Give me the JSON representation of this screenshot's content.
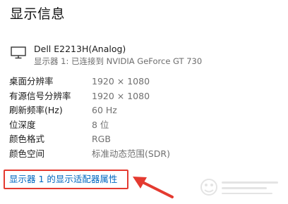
{
  "page": {
    "title": "显示信息"
  },
  "monitor": {
    "icon": "monitor-icon",
    "name": "Dell E2213H(Analog)",
    "subtitle": "显示器 1: 已连接到 NVIDIA GeForce GT 730"
  },
  "info": {
    "rows": [
      {
        "label": "桌面分辨率",
        "value": "1920 × 1080"
      },
      {
        "label": "有源信号分辨率",
        "value": "1920 × 1080"
      },
      {
        "label": "刷新频率(Hz)",
        "value": "60 Hz"
      },
      {
        "label": "位深度",
        "value": "8 位"
      },
      {
        "label": "颜色格式",
        "value": "RGB"
      },
      {
        "label": "颜色空间",
        "value": "标准动态范围(SDR)"
      }
    ]
  },
  "link": {
    "adapter_properties": "显示器 1 的显示适配器属性"
  },
  "annotation": {
    "highlight_color": "#e43a30",
    "arrow_color": "#e43a30"
  },
  "colors": {
    "link": "#0067c0",
    "value_text": "#707070"
  },
  "watermark": {
    "icon": "baidu-jingyan-watermark"
  }
}
